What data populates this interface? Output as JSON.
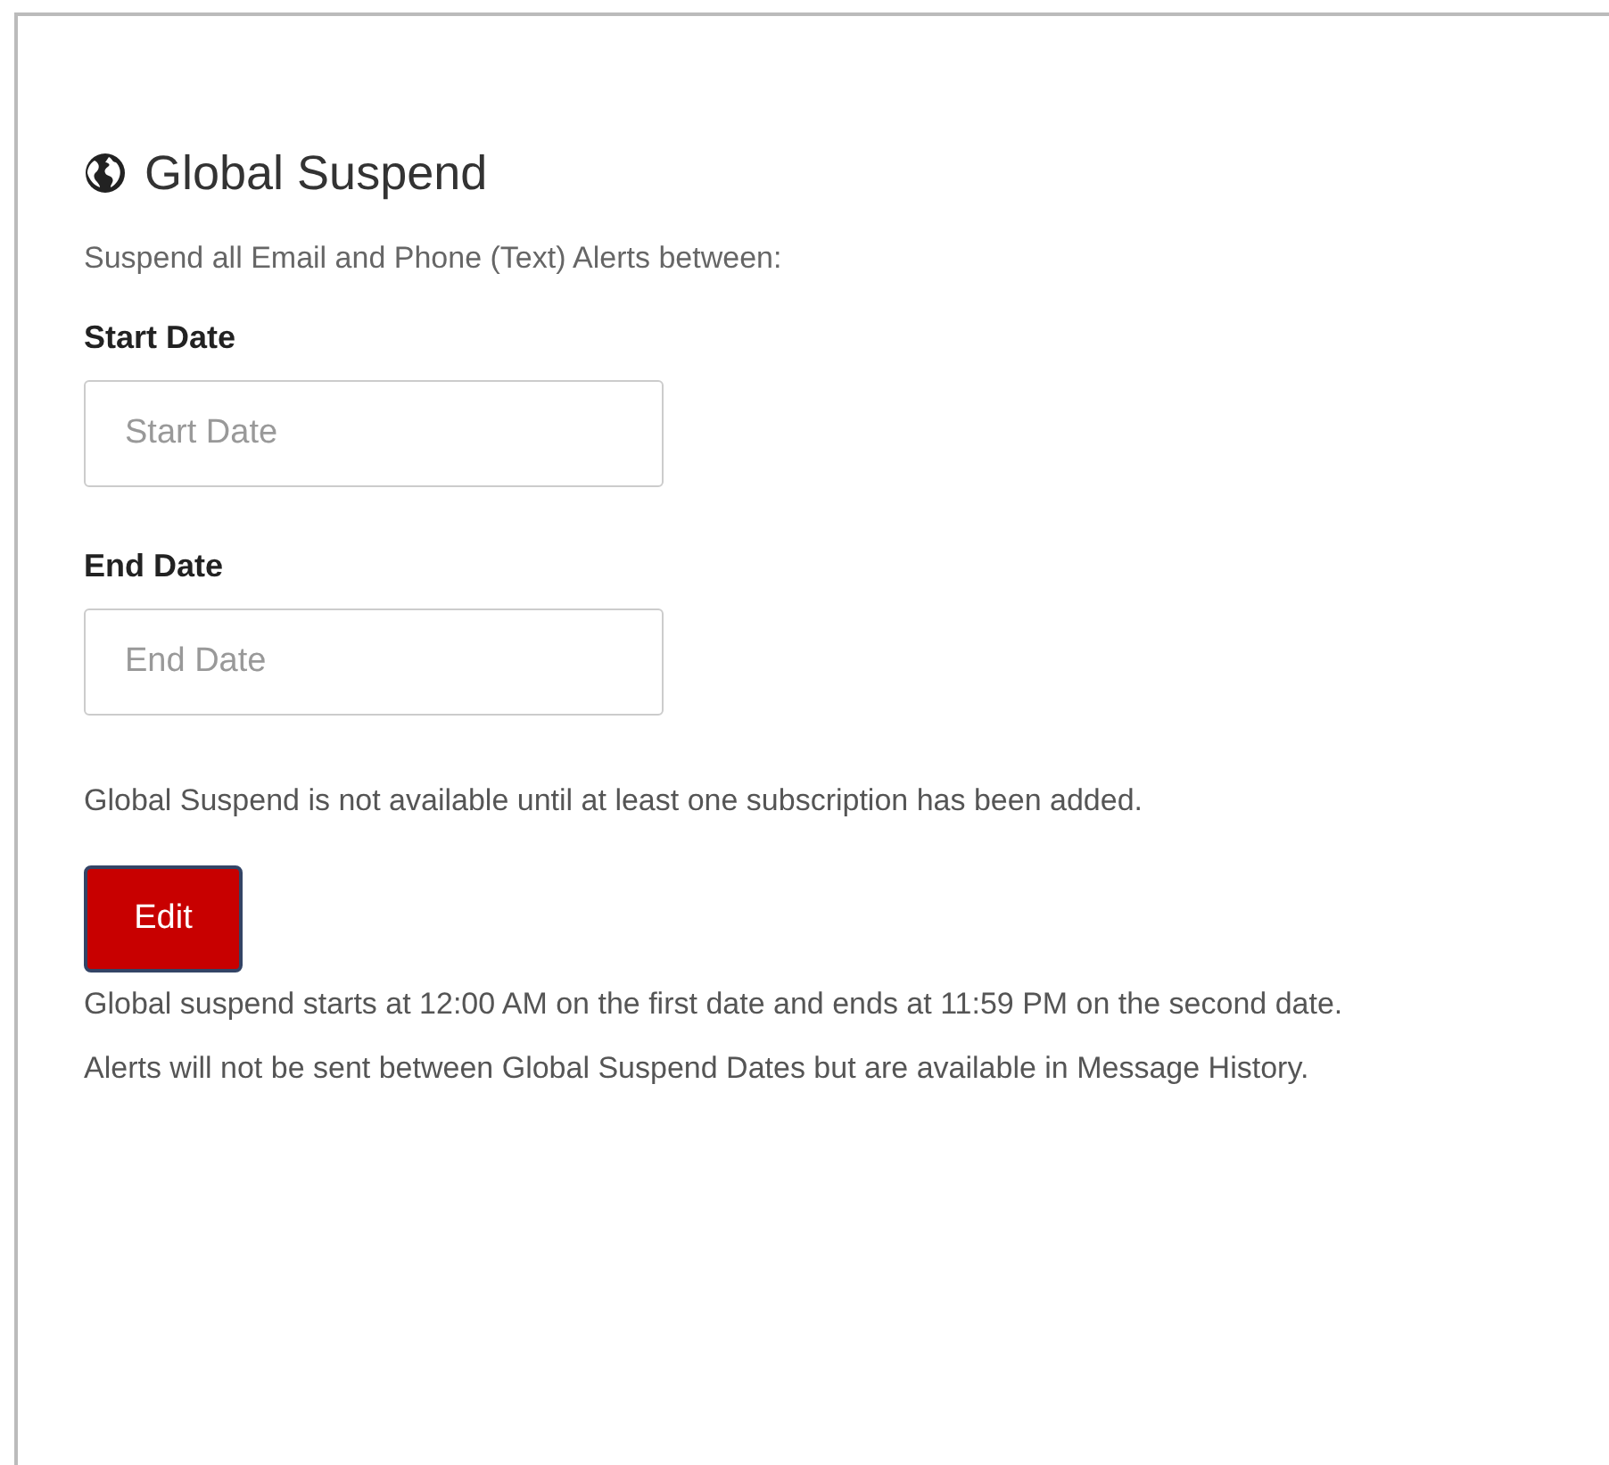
{
  "panel": {
    "title": "Global Suspend",
    "intro": "Suspend all Email and Phone (Text) Alerts between:",
    "fields": [
      {
        "label": "Start Date",
        "placeholder": "Start Date"
      },
      {
        "label": "End Date",
        "placeholder": "End Date"
      }
    ],
    "notice": "Global Suspend is not available until at least one subscription has been added.",
    "edit_button": "Edit",
    "notes": [
      "Global suspend starts at 12:00 AM on the first date and ends at 11:59 PM on the second date.",
      "Alerts will not be sent between Global Suspend Dates but are available in Message History."
    ]
  }
}
